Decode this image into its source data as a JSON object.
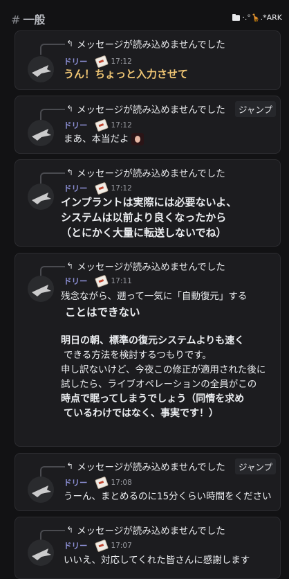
{
  "header": {
    "channel_hash": "#",
    "channel_name": "一般",
    "server_tag": "·.°🦒.*ARK",
    "folder_icon": "folder-icon"
  },
  "messages": [
    {
      "reply_text": "メッセージが読み込めませんでした",
      "jump_label": "",
      "author": "ドリー",
      "time": "17:12",
      "lines": [
        "うん！ちょっと入力させて"
      ]
    },
    {
      "reply_text": "メッセージが読み込めませんでした",
      "jump_label": "ジャンプ",
      "author": "ドリー",
      "time": "17:12",
      "lines": [
        "まあ、本当だよ"
      ]
    },
    {
      "reply_text": "メッセージが読み込めませんでした",
      "jump_label": "",
      "author": "ドリー",
      "time": "17:12",
      "lines": [
        "インプラントは実際には必要ないよ、",
        "システムは以前より良くなったから",
        "（とにかく大量に転送しないでね）"
      ]
    },
    {
      "reply_text": "メッセージが読み込めませんでした",
      "jump_label": "",
      "author": "ドリー",
      "time": "17:11",
      "lines": [
        "残念ながら、遡って一気に「自動復元」する",
        "ことはできない",
        "",
        "明日の朝、標準の復元システムよりも速く",
        "できる方法を検討するつもりです。",
        "申し訳ないけど、今夜この修正が適用された後に",
        "試したら、ライブオペレーションの全員がこの",
        "時点で眠ってしまうでしょう（同情を求め",
        "ているわけではなく、事実です！）"
      ]
    },
    {
      "reply_text": "メッセージが読み込めませんでした",
      "jump_label": "ジャンプ",
      "author": "ドリー",
      "time": "17:08",
      "lines": [
        "うーん、まとめるのに15分くらい時間をください"
      ]
    },
    {
      "reply_text": "メッセージが読み込めませんでした",
      "jump_label": "",
      "author": "ドリー",
      "time": "17:07",
      "lines": [
        "いいえ、対応してくれた皆さんに感謝します"
      ]
    }
  ]
}
